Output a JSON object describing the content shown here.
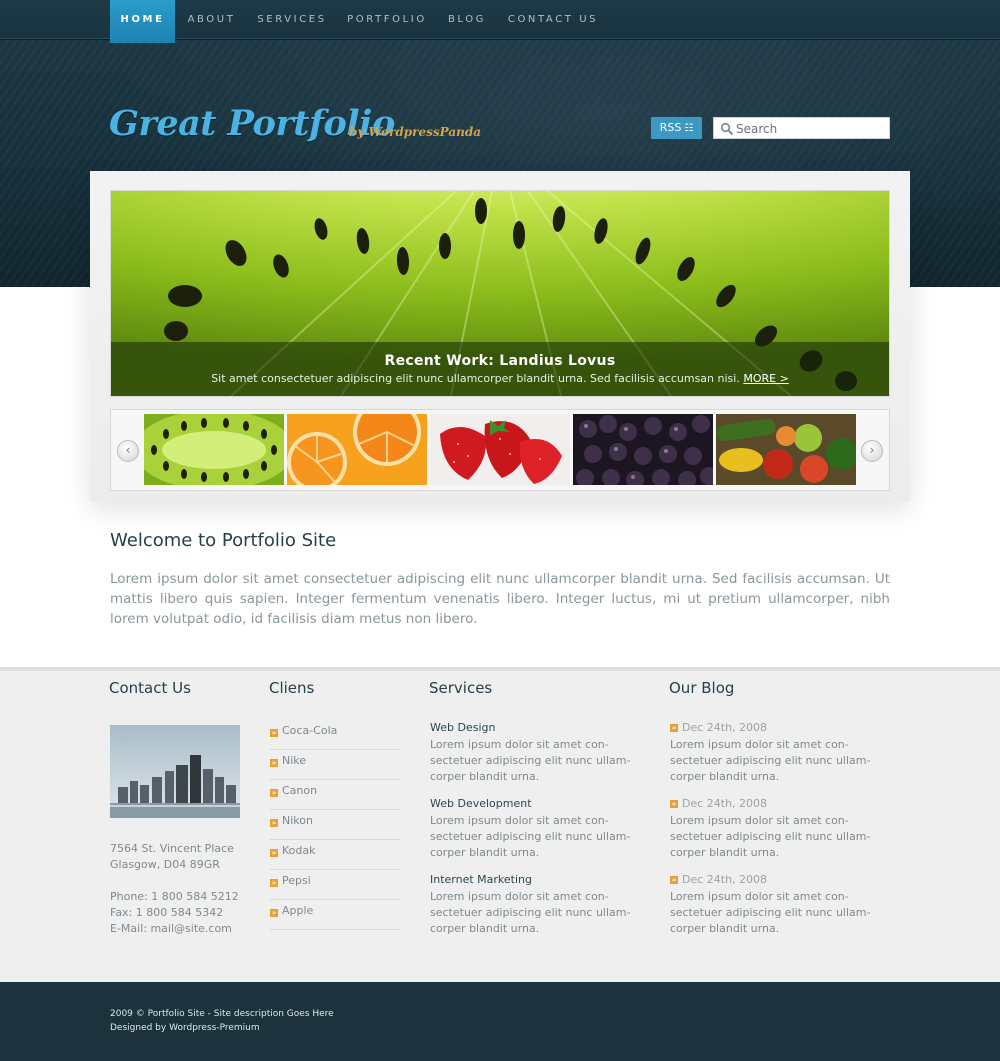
{
  "nav": {
    "items": [
      "HOME",
      "ABOUT",
      "SERVICES",
      "PORTFOLIO",
      "BLOG",
      "CONTACT US"
    ],
    "active": "HOME"
  },
  "logo": {
    "main": "Great Portfolio",
    "sub": "by WordpressPanda"
  },
  "header": {
    "rss_label": "RSS",
    "search_placeholder": "Search"
  },
  "hero": {
    "title": "Recent Work: Landius Lovus",
    "text": "Sit amet consectetuer adipiscing elit nunc ullamcorper blandit urna. Sed facilisis accumsan nisi.",
    "more_label": "MORE >"
  },
  "thumbnails": [
    "kiwi",
    "orange",
    "strawberry",
    "blackberry",
    "vegetables"
  ],
  "welcome": {
    "title": "Welcome to Portfolio Site",
    "text": "Lorem ipsum dolor sit amet consectetuer adipiscing elit nunc ullamcorper blandit urna. Sed facilisis accumsan. Ut mattis libero quis sapien. Integer fermentum venenatis libero. Integer luctus, mi ut pretium ullamcorper, nibh lorem volutpat odio, id facilisis diam metus non libero."
  },
  "contact": {
    "title": "Contact Us",
    "address_line1": "7564 St. Vincent Place",
    "address_line2": "Glasgow, D04 89GR",
    "phone": "Phone: 1 800 584 5212",
    "fax": "Fax: 1 800 584 5342",
    "email": "E-Mail: mail@site.com"
  },
  "clients": {
    "title": "Cliens",
    "items": [
      "Coca-Cola",
      "Nike",
      "Canon",
      "Nikon",
      "Kodak",
      "Pepsi",
      "Apple"
    ]
  },
  "services": {
    "title": "Services",
    "items": [
      {
        "title": "Web Design",
        "line1": "Lorem ipsum dolor sit amet con-",
        "line2": "sectetuer adipiscing elit nunc ullam-",
        "line3": "corper blandit urna."
      },
      {
        "title": "Web Development",
        "line1": "Lorem ipsum dolor sit amet con-",
        "line2": "sectetuer adipiscing elit nunc ullam-",
        "line3": "corper blandit urna."
      },
      {
        "title": "Internet Marketing",
        "line1": "Lorem ipsum dolor sit amet con-",
        "line2": "sectetuer adipiscing elit nunc ullam-",
        "line3": "corper blandit urna."
      }
    ]
  },
  "blog": {
    "title": "Our Blog",
    "items": [
      {
        "date": "Dec 24th, 2008",
        "line1": "Lorem ipsum dolor sit amet con-",
        "line2": "sectetuer adipiscing elit nunc ullam-",
        "line3": "corper blandit urna."
      },
      {
        "date": "Dec 24th, 2008",
        "line1": "Lorem ipsum dolor sit amet con-",
        "line2": "sectetuer adipiscing elit nunc ullam-",
        "line3": "corper blandit urna."
      },
      {
        "date": "Dec 24th, 2008",
        "line1": "Lorem ipsum dolor sit amet con-",
        "line2": "sectetuer adipiscing elit nunc ullam-",
        "line3": "corper blandit urna."
      }
    ]
  },
  "footer": {
    "copyright": "2009 © Portfolio Site - Site description Goes Here",
    "designed_by": "Designed by Wordpress-Premium"
  },
  "colors": {
    "nav_active": "#2b9ccc",
    "header_bg": "#1a3540",
    "logo_blue": "#4bb3e3",
    "logo_sub_gold": "#d4a34e",
    "bullet_orange": "#e6a135",
    "footer_bg": "#1c323c"
  },
  "icons": [
    "rss-icon",
    "search-icon",
    "arrow-left-icon",
    "arrow-right-icon",
    "bullet-arrow-icon"
  ]
}
